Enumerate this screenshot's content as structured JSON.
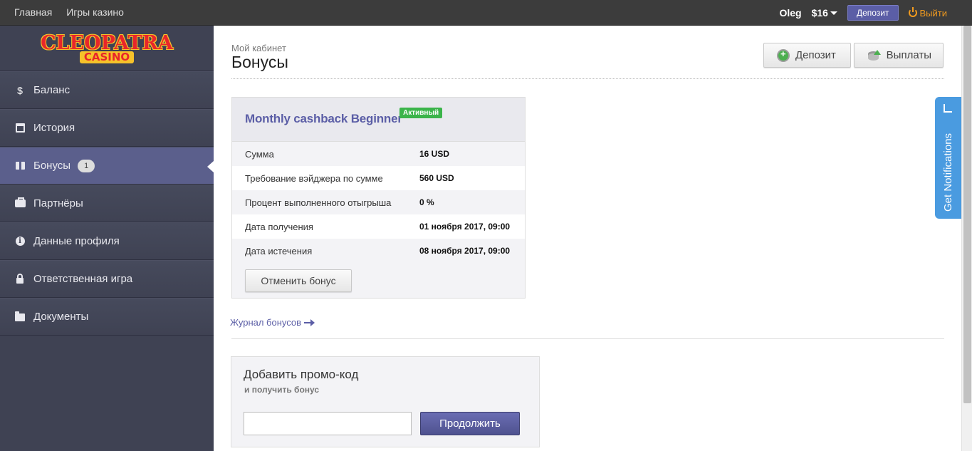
{
  "topbar": {
    "nav": [
      "Главная",
      "Игры казино"
    ],
    "user": "Oleg",
    "balance": "$16",
    "deposit_label": "Депозит",
    "exit_label": "Выйти"
  },
  "logo": {
    "top": "CLEOPATRA",
    "bottom": "CASINO"
  },
  "sidebar": {
    "items": [
      {
        "label": "Баланс",
        "icon": "dollar-icon"
      },
      {
        "label": "История",
        "icon": "calendar-icon"
      },
      {
        "label": "Бонусы",
        "icon": "gift-icon",
        "badge": "1",
        "active": true
      },
      {
        "label": "Партнёры",
        "icon": "briefcase-icon"
      },
      {
        "label": "Данные профиля",
        "icon": "info-icon"
      },
      {
        "label": "Ответственная игра",
        "icon": "lock-icon"
      },
      {
        "label": "Документы",
        "icon": "folder-icon"
      }
    ]
  },
  "page": {
    "breadcrumb": "Мой кабинет",
    "title": "Бонусы",
    "deposit_button": "Депозит",
    "payouts_button": "Выплаты"
  },
  "bonus": {
    "name": "Monthly cashback Beginner",
    "status": "Активный",
    "rows": [
      {
        "label": "Сумма",
        "value": "16 USD"
      },
      {
        "label": "Требование вэйджера по сумме",
        "value": "560 USD"
      },
      {
        "label": "Процент выполненного отыгрыша",
        "value": "0 %"
      },
      {
        "label": "Дата получения",
        "value": "01 ноября 2017, 09:00"
      },
      {
        "label": "Дата истечения",
        "value": "08 ноября 2017, 09:00"
      }
    ],
    "cancel_button": "Отменить бонус"
  },
  "journal_link": "Журнал бонусов",
  "promo": {
    "title": "Добавить промо-код",
    "subtitle": "и получить бонус",
    "input_value": "",
    "submit_button": "Продолжить"
  },
  "notifications_tab": "Get Notifications",
  "colors": {
    "accent": "#5b5ea6",
    "sidebar_bg": "#3f4253",
    "active_badge": "#3bb44a",
    "exit": "#f29b1e",
    "notif": "#4a9be0"
  }
}
